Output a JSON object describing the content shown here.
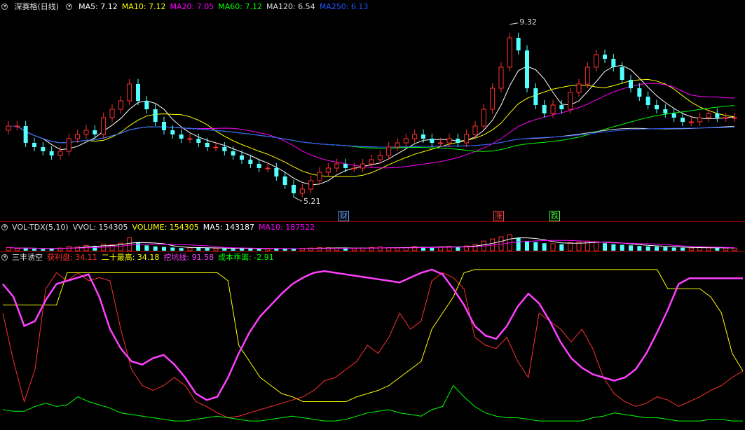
{
  "main": {
    "title": "深赛格(日线)",
    "ma": [
      {
        "label": "MA5: 7.12",
        "color": "#ffffff"
      },
      {
        "label": "MA10: 7.12",
        "color": "#ffff00"
      },
      {
        "label": "MA20: 7.05",
        "color": "#ff00ff"
      },
      {
        "label": "MA60: 7.12",
        "color": "#00ff00"
      },
      {
        "label": "MA120: 6.54",
        "color": "#dddddd"
      },
      {
        "label": "MA250: 6.13",
        "color": "#2255ff"
      }
    ],
    "high_label": "9.32",
    "low_label": "5.21",
    "markers": [
      {
        "text": "财",
        "color": "#66aaff"
      },
      {
        "text": "涨",
        "color": "#ff4444"
      },
      {
        "text": "跌",
        "color": "#44ff44"
      }
    ]
  },
  "volume": {
    "legend": [
      {
        "label": "VOL-TDX(5,10)",
        "color": "#dddddd"
      },
      {
        "label": "VVOL: 154305",
        "color": "#dddddd"
      },
      {
        "label": "VOLUME: 154305",
        "color": "#ffff00"
      },
      {
        "label": "MA5: 143187",
        "color": "#ffffff"
      },
      {
        "label": "MA10: 187522",
        "color": "#ff00ff"
      }
    ]
  },
  "indicator": {
    "legend": [
      {
        "label": "三丰诱空",
        "color": "#dddddd"
      },
      {
        "label": "获利盘: 34.11",
        "color": "#ff3030"
      },
      {
        "label": "二十最高: 34.18",
        "color": "#ffff00"
      },
      {
        "label": "挖坑线: 91.58",
        "color": "#ff40ff"
      },
      {
        "label": "成本乖离: -2.91",
        "color": "#00ff00"
      }
    ]
  },
  "chart_data": [
    {
      "type": "line",
      "name": "price",
      "ylim": [
        4.9,
        9.6
      ],
      "closes": [
        6.9,
        6.9,
        6.5,
        6.4,
        6.3,
        6.2,
        6.3,
        6.6,
        6.7,
        6.8,
        6.7,
        7.1,
        7.3,
        7.5,
        7.9,
        7.5,
        7.3,
        7.0,
        6.8,
        6.7,
        6.6,
        6.6,
        6.5,
        6.4,
        6.4,
        6.3,
        6.2,
        6.1,
        6.0,
        5.9,
        5.9,
        5.7,
        5.5,
        5.3,
        5.4,
        5.6,
        5.8,
        5.9,
        6.0,
        5.9,
        5.9,
        6.0,
        6.1,
        6.2,
        6.4,
        6.5,
        6.6,
        6.7,
        6.6,
        6.5,
        6.5,
        6.6,
        6.5,
        6.7,
        6.9,
        7.3,
        7.8,
        8.3,
        9.0,
        8.7,
        7.8,
        7.4,
        7.2,
        7.4,
        7.3,
        7.7,
        7.9,
        8.3,
        8.6,
        8.5,
        8.3,
        8.0,
        7.8,
        7.6,
        7.4,
        7.3,
        7.2,
        7.1,
        7.0,
        7.0,
        7.1,
        7.2,
        7.1,
        7.1,
        7.1
      ],
      "high": 9.32,
      "low": 5.21
    },
    {
      "type": "bar",
      "name": "volume",
      "values": [
        30,
        20,
        25,
        18,
        15,
        20,
        25,
        40,
        35,
        50,
        45,
        60,
        55,
        70,
        120,
        80,
        50,
        40,
        35,
        30,
        25,
        28,
        30,
        25,
        22,
        20,
        18,
        25,
        20,
        15,
        18,
        22,
        20,
        18,
        22,
        25,
        30,
        28,
        25,
        22,
        20,
        25,
        30,
        35,
        28,
        25,
        30,
        40,
        35,
        30,
        35,
        40,
        38,
        45,
        60,
        90,
        110,
        130,
        150,
        120,
        90,
        80,
        70,
        65,
        60,
        75,
        80,
        90,
        85,
        70,
        60,
        55,
        50,
        45,
        40,
        38,
        35,
        30,
        28,
        25,
        30,
        28,
        26,
        25,
        25
      ]
    },
    {
      "type": "line",
      "name": "indicator",
      "ylim": [
        0,
        100
      ],
      "series": [
        {
          "name": "获利盘",
          "color": "#ff3030",
          "values": [
            70,
            40,
            15,
            35,
            85,
            95,
            90,
            95,
            90,
            92,
            90,
            60,
            35,
            25,
            22,
            25,
            30,
            25,
            15,
            12,
            8,
            5,
            6,
            8,
            10,
            12,
            14,
            16,
            18,
            22,
            28,
            30,
            35,
            40,
            50,
            45,
            55,
            70,
            60,
            65,
            90,
            95,
            92,
            85,
            55,
            50,
            48,
            55,
            40,
            30,
            70,
            65,
            60,
            52,
            60,
            48,
            30,
            20,
            15,
            12,
            14,
            18,
            16,
            12,
            15,
            18,
            22,
            25,
            30,
            34
          ]
        },
        {
          "name": "二十最高",
          "color": "#ffff00",
          "values": [
            75,
            75,
            75,
            75,
            75,
            75,
            95,
            95,
            95,
            95,
            95,
            95,
            95,
            95,
            95,
            95,
            95,
            95,
            95,
            95,
            95,
            90,
            50,
            40,
            30,
            25,
            20,
            18,
            15,
            15,
            15,
            15,
            15,
            18,
            20,
            22,
            25,
            30,
            35,
            40,
            60,
            70,
            80,
            95,
            97,
            97,
            97,
            97,
            97,
            97,
            97,
            97,
            97,
            97,
            97,
            97,
            97,
            97,
            97,
            97,
            97,
            97,
            85,
            85,
            85,
            85,
            80,
            70,
            45,
            34
          ]
        },
        {
          "name": "挖坑线",
          "color": "#ff40ff",
          "values": [
            88,
            80,
            62,
            65,
            78,
            88,
            90,
            92,
            94,
            80,
            60,
            48,
            40,
            38,
            42,
            44,
            38,
            30,
            20,
            16,
            18,
            30,
            45,
            58,
            68,
            75,
            82,
            88,
            92,
            95,
            96,
            95,
            94,
            93,
            92,
            91,
            90,
            89,
            92,
            95,
            97,
            94,
            85,
            75,
            62,
            56,
            54,
            62,
            74,
            82,
            76,
            65,
            52,
            42,
            36,
            32,
            30,
            28,
            30,
            35,
            45,
            58,
            72,
            88,
            91.58,
            91.58,
            91.58,
            91.58,
            91.58,
            91.58
          ]
        },
        {
          "name": "成本乖离",
          "color": "#00ff00",
          "values": [
            10,
            9,
            9,
            12,
            14,
            12,
            13,
            18,
            15,
            13,
            11,
            8,
            7,
            6,
            5,
            4,
            3,
            3,
            4,
            5,
            6,
            5,
            4,
            3,
            3,
            4,
            5,
            6,
            5,
            4,
            3,
            3,
            4,
            6,
            8,
            9,
            10,
            8,
            7,
            6,
            10,
            12,
            25,
            18,
            12,
            8,
            6,
            5,
            5,
            4,
            3,
            3,
            3,
            3,
            3,
            5,
            6,
            8,
            7,
            6,
            5,
            5,
            4,
            3,
            3,
            3,
            4,
            4,
            3,
            3
          ]
        }
      ]
    }
  ]
}
